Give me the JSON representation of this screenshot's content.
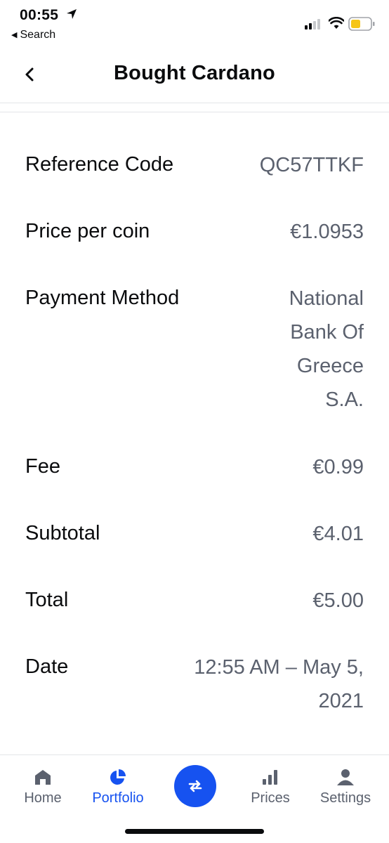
{
  "status_bar": {
    "time": "00:55",
    "back_app": "Search",
    "icons": [
      "location-arrow-icon",
      "cellular-signal-icon",
      "wifi-icon",
      "battery-icon"
    ]
  },
  "header": {
    "title": "Bought Cardano",
    "back_icon": "chevron-left-icon"
  },
  "details": [
    {
      "label": "Reference Code",
      "value": "QC57TTKF"
    },
    {
      "label": "Price per coin",
      "value": "€1.0953"
    },
    {
      "label": "Payment Method",
      "value_lines": [
        "National",
        "Bank Of",
        "Greece",
        "S.A."
      ]
    },
    {
      "label": "Fee",
      "value": "€0.99"
    },
    {
      "label": "Subtotal",
      "value": "€4.01"
    },
    {
      "label": "Total",
      "value": "€5.00"
    },
    {
      "label": "Date",
      "value_lines": [
        "12:55 AM – May 5,",
        "2021"
      ]
    }
  ],
  "tab_bar": {
    "tabs": [
      {
        "label": "Home",
        "icon": "home-icon",
        "active": false
      },
      {
        "label": "Portfolio",
        "icon": "pie-chart-icon",
        "active": true
      },
      {
        "label": "Prices",
        "icon": "bar-chart-icon",
        "active": false
      },
      {
        "label": "Settings",
        "icon": "person-icon",
        "active": false
      }
    ],
    "trade_icon": "swap-arrows-icon"
  },
  "colors": {
    "accent": "#1652f0",
    "text_primary": "#0a0b0d",
    "text_secondary": "#5b616e",
    "divider": "#e3e5e8",
    "battery_fill": "#f5c518"
  }
}
